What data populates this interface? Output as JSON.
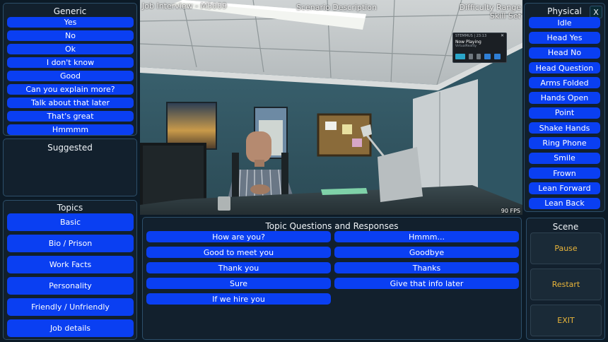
{
  "generic": {
    "title": "Generic",
    "buttons": [
      "Yes",
      "No",
      "Ok",
      "I don't know",
      "Good",
      "Can you explain more?",
      "Talk about that later",
      "That's great",
      "Hmmmm"
    ]
  },
  "suggested": {
    "title": "Suggested"
  },
  "topics": {
    "title": "Topics",
    "buttons": [
      "Basic",
      "Bio / Prison",
      "Work Facts",
      "Personality",
      "Friendly / Unfriendly",
      "Job details"
    ]
  },
  "physical": {
    "title": "Physical",
    "close_label": "X",
    "buttons": [
      "Idle",
      "Head Yes",
      "Head No",
      "Head Question",
      "Arms Folded",
      "Hands Open",
      "Point",
      "Shake Hands",
      "Ring Phone",
      "Smile",
      "Frown",
      "Lean Forward",
      "Lean Back"
    ]
  },
  "questions": {
    "title": "Topic Questions and Responses",
    "left": [
      "How are you?",
      "Good to meet you",
      "Thank you",
      "Sure",
      "If we hire you"
    ],
    "right": [
      "Hmmm...",
      "Goodbye",
      "Thanks",
      "Give that info later"
    ]
  },
  "scene": {
    "title": "Scene",
    "buttons": [
      "Pause",
      "Restart",
      "EXIT"
    ]
  },
  "viewport": {
    "title": "Job Interview - M5009",
    "scenario": "Scenario Description",
    "difficulty": "Difficulty Range",
    "skill": "Skill Set",
    "fps": "90 FPS"
  },
  "media_popup": {
    "header": "STEMMUS | 23:13",
    "title": "Now Playing",
    "subtitle": "VirtualReality",
    "close": "✕"
  },
  "colors": {
    "button_blue": "#0a3ff2",
    "panel_bg": "#12202d",
    "panel_border": "#2d4f6a",
    "scene_text": "#e9b53a"
  }
}
